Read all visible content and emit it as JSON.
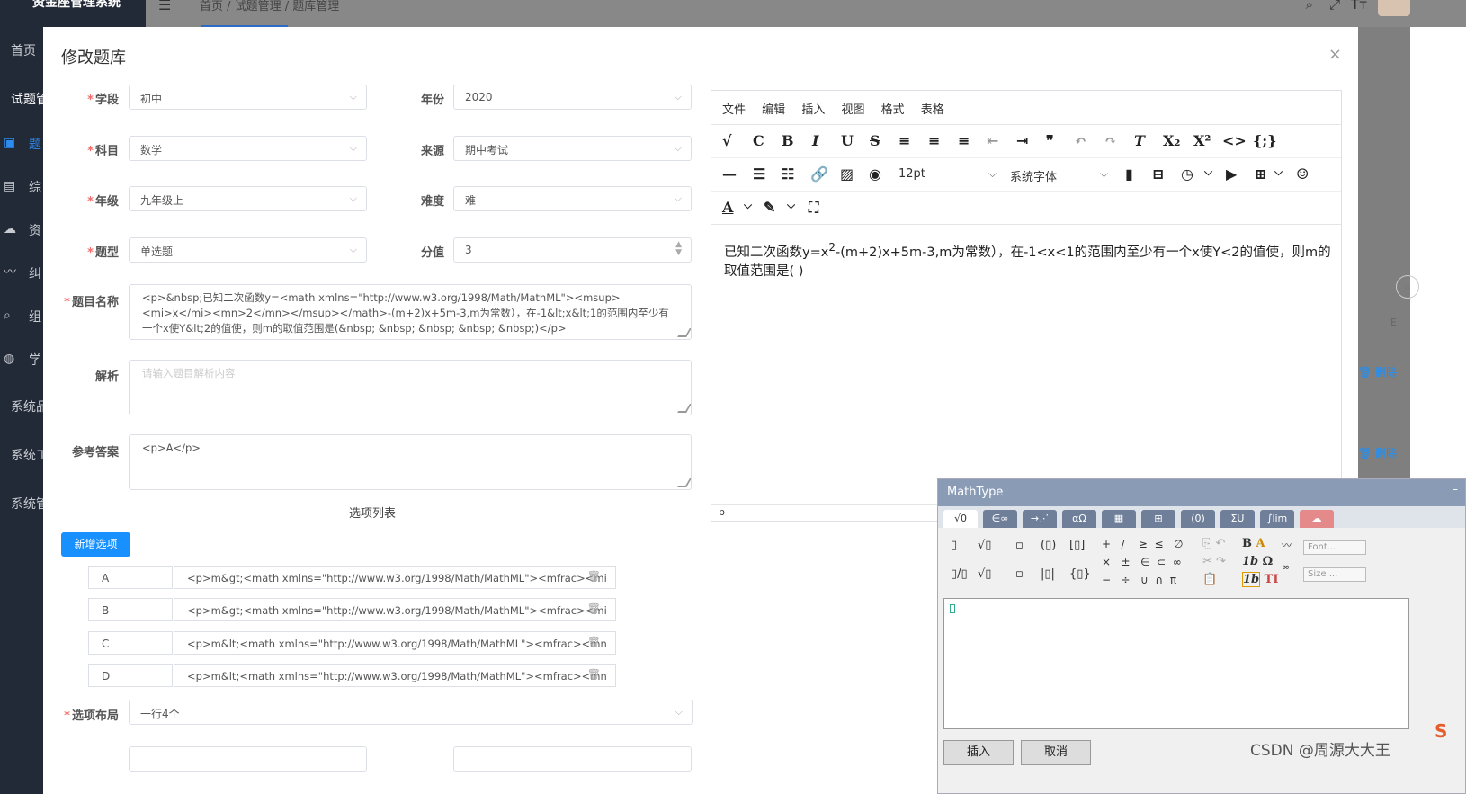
{
  "app": {
    "title": "资金座管理系统"
  },
  "sidebar": {
    "items": [
      "首页",
      "试题管",
      "题",
      "综",
      "资",
      "纠",
      "组",
      "学",
      "系统品",
      "系统工",
      "系统管"
    ]
  },
  "topbar": {
    "menu_icon": "menu-icon",
    "breadcrumb": "首页  /  试题管理  /  题库管理"
  },
  "dialog": {
    "title": "修改题库",
    "close": "×",
    "fields": {
      "stage": {
        "label": "学段",
        "value": "初中"
      },
      "year": {
        "label": "年份",
        "value": "2020"
      },
      "subject": {
        "label": "科目",
        "value": "数学"
      },
      "source": {
        "label": "来源",
        "value": "期中考试"
      },
      "grade": {
        "label": "年级",
        "value": "九年级上"
      },
      "difficulty": {
        "label": "难度",
        "value": "难"
      },
      "type": {
        "label": "题型",
        "value": "单选题"
      },
      "score": {
        "label": "分值",
        "value": "3"
      },
      "name": {
        "label": "题目名称",
        "value": "<p>&nbsp;已知二次函数y=<math xmlns=\"http://www.w3.org/1998/Math/MathML\"><msup><mi>x</mi><mn>2</mn></msup></math>-(m+2)x+5m-3,m为常数），在-1&lt;x&lt;1的范围内至少有一个x使Y&lt;2的值使，则m的取值范围是(&nbsp; &nbsp; &nbsp; &nbsp; &nbsp;)</p>"
      },
      "analysis": {
        "label": "解析",
        "placeholder": "请输入题目解析内容"
      },
      "answer": {
        "label": "参考答案",
        "value": "<p>A</p>"
      },
      "layout": {
        "label": "选项布局",
        "value": "一行4个"
      }
    },
    "options_title": "选项列表",
    "add_option": "新增选项",
    "options": [
      {
        "letter": "A",
        "value": "<p>m&gt;<math xmlns=\"http://www.w3.org/1998/Math/MathML\"><mfrac><mi"
      },
      {
        "letter": "B",
        "value": "<p>m&gt;<math xmlns=\"http://www.w3.org/1998/Math/MathML\"><mfrac><mi"
      },
      {
        "letter": "C",
        "value": "<p>m&lt;<math xmlns=\"http://www.w3.org/1998/Math/MathML\"><mfrac><mn"
      },
      {
        "letter": "D",
        "value": "<p>m&lt;<math xmlns=\"http://www.w3.org/1998/Math/MathML\"><mfrac><mn"
      }
    ]
  },
  "editor": {
    "menu": [
      "文件",
      "编辑",
      "插入",
      "视图",
      "格式",
      "表格"
    ],
    "font_size": "12pt",
    "font_family": "系统字体",
    "content_pre": "已知二次函数y=x",
    "content_sup": "2",
    "content_post": "-(m+2)x+5m-3,m为常数），在-1<x<1的范围内至少有一个x使Y<2的值使，则m的取值范围是(        )",
    "status": "p"
  },
  "mathtype": {
    "title": "MathType",
    "tabs": [
      "√0",
      "∈∞",
      "→⋰",
      "αΩ",
      "▦",
      "⊞",
      "(0)",
      "ΣU",
      "∫lim",
      "☁"
    ],
    "font_box": "Font...",
    "size_box": "Size ...",
    "insert": "插入",
    "cancel": "取消"
  },
  "right_panel": {
    "delete": "删除",
    "letter": "E"
  },
  "watermark": "CSDN @周源大大王"
}
